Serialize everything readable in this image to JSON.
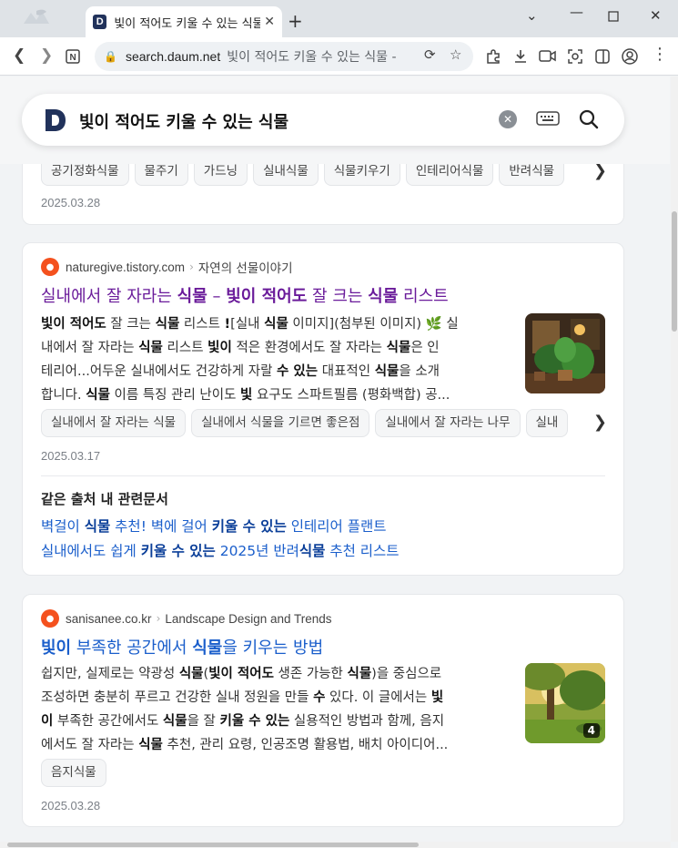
{
  "browser": {
    "tab_title": "빛이 적어도 키울 수 있는 식물",
    "tab_favicon_letter": "D",
    "url_host": "search.daum.net",
    "url_query": "빛이 적어도 키울 수 있는 식물 -"
  },
  "search": {
    "query": "빛이 적어도 키울 수 있는 식물"
  },
  "top_card": {
    "chips": [
      "공기정화식물",
      "물주기",
      "가드닝",
      "실내식물",
      "식물키우기",
      "인테리어식물",
      "반려식물"
    ],
    "date": "2025.03.28"
  },
  "result1": {
    "host": "naturegive.tistory.com",
    "blog_name": "자연의 선물이야기",
    "title_parts": [
      {
        "t": "실내에서 잘 자라는 ",
        "b": false
      },
      {
        "t": "식물",
        "b": true
      },
      {
        "t": " – ",
        "b": false
      },
      {
        "t": "빛이 적어도",
        "b": true
      },
      {
        "t": " 잘 크는 ",
        "b": false
      },
      {
        "t": "식물",
        "b": true
      },
      {
        "t": " 리스트",
        "b": false
      }
    ],
    "snippet_lines": [
      [
        {
          "t": "빛이 적어도",
          "b": true
        },
        {
          "t": " 잘 크는 ",
          "b": false
        },
        {
          "t": "식물",
          "b": true
        },
        {
          "t": " 리스트 ",
          "b": false
        },
        {
          "t": "!",
          "b": true
        },
        {
          "t": "[실내 ",
          "b": false
        },
        {
          "t": "식물",
          "b": true
        },
        {
          "t": " 이미지](첨부된 이미지) 🌿 실",
          "b": false
        }
      ],
      [
        {
          "t": "내에서 잘 자라는 ",
          "b": false
        },
        {
          "t": "식물",
          "b": true
        },
        {
          "t": " 리스트 ",
          "b": false
        },
        {
          "t": "빛이",
          "b": true
        },
        {
          "t": " 적은 환경에서도 잘 자라는 ",
          "b": false
        },
        {
          "t": "식물",
          "b": true
        },
        {
          "t": "은 인",
          "b": false
        }
      ],
      [
        {
          "t": "테리어...어두운 실내에서도 건강하게 자랄 ",
          "b": false
        },
        {
          "t": "수 있는",
          "b": true
        },
        {
          "t": " 대표적인 ",
          "b": false
        },
        {
          "t": "식물",
          "b": true
        },
        {
          "t": "을 소개",
          "b": false
        }
      ],
      [
        {
          "t": "합니다. ",
          "b": false
        },
        {
          "t": "식물",
          "b": true
        },
        {
          "t": " 이름 특징 관리 난이도 ",
          "b": false
        },
        {
          "t": "빛",
          "b": true
        },
        {
          "t": " 요구도 스파트필름 (평화백합) 공...",
          "b": false
        }
      ]
    ],
    "chips": [
      "실내에서 잘 자라는 식물",
      "실내에서 식물을 기르면 좋은점",
      "실내에서 잘 자라는 나무",
      "실내"
    ],
    "date": "2025.03.17",
    "related_heading": "같은 출처 내 관련문서",
    "related": [
      [
        {
          "t": "벽걸이 ",
          "b": false
        },
        {
          "t": "식물",
          "b": true
        },
        {
          "t": " 추천! 벽에 걸어 ",
          "b": false
        },
        {
          "t": "키울 수 있는",
          "b": true
        },
        {
          "t": " 인테리어 플랜트",
          "b": false
        }
      ],
      [
        {
          "t": "실내에서도 쉽게 ",
          "b": false
        },
        {
          "t": "키울 수 있는",
          "b": true
        },
        {
          "t": " 2025년 반려",
          "b": false
        },
        {
          "t": "식물",
          "b": true
        },
        {
          "t": " 추천 리스트",
          "b": false
        }
      ]
    ]
  },
  "result2": {
    "host": "sanisanee.co.kr",
    "blog_name": "Landscape Design and Trends",
    "title_parts": [
      {
        "t": "빛이",
        "b": true
      },
      {
        "t": " 부족한 공간에서 ",
        "b": false
      },
      {
        "t": "식물",
        "b": true
      },
      {
        "t": "을 키우는 방법",
        "b": false
      }
    ],
    "snippet_lines": [
      [
        {
          "t": "쉽지만, 실제로는 약광성 ",
          "b": false
        },
        {
          "t": "식물",
          "b": true
        },
        {
          "t": "(",
          "b": false
        },
        {
          "t": "빛이 적어도",
          "b": true
        },
        {
          "t": " 생존 가능한 ",
          "b": false
        },
        {
          "t": "식물",
          "b": true
        },
        {
          "t": ")을 중심으로",
          "b": false
        }
      ],
      [
        {
          "t": "조성하면 충분히 푸르고 건강한 실내 정원을 만들 ",
          "b": false
        },
        {
          "t": "수",
          "b": true
        },
        {
          "t": " 있다. 이 글에서는 ",
          "b": false
        },
        {
          "t": "빛",
          "b": true
        }
      ],
      [
        {
          "t": "이",
          "b": true
        },
        {
          "t": " 부족한 공간에서도 ",
          "b": false
        },
        {
          "t": "식물",
          "b": true
        },
        {
          "t": "을 잘 ",
          "b": false
        },
        {
          "t": "키울 수 있는",
          "b": true
        },
        {
          "t": " 실용적인 방법과 함께, 음지",
          "b": false
        }
      ],
      [
        {
          "t": "에서도 잘 자라는 ",
          "b": false
        },
        {
          "t": "식물",
          "b": true
        },
        {
          "t": " 추천, 관리 요령, 인공조명 활용법, 배치 아이디어...",
          "b": false
        }
      ]
    ],
    "image_count": "4",
    "chips": [
      "음지식물"
    ],
    "date": "2025.03.28"
  },
  "colors": {
    "visited_title": "#6a1b9a",
    "link_title": "#1a5ecb",
    "daum_navy": "#21325b",
    "source_icon": "#f4511e"
  }
}
